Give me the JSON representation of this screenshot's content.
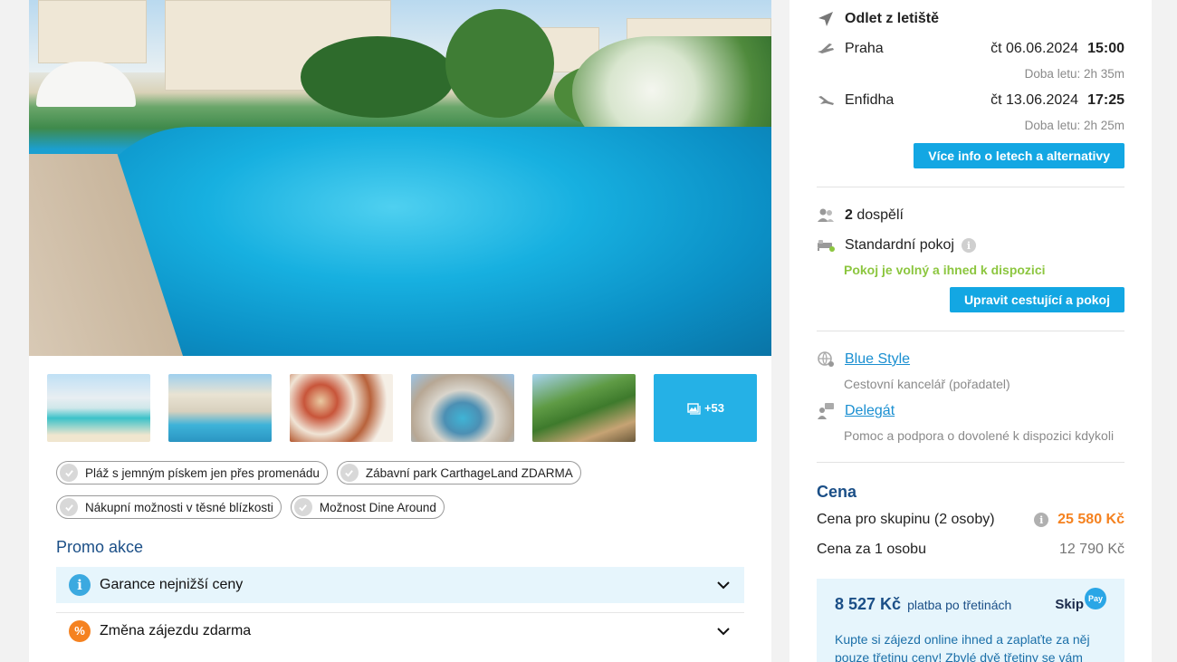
{
  "gallery": {
    "more_count": "+53"
  },
  "tags": [
    "Pláž s jemným pískem jen přes promenádu",
    "Zábavní park CarthageLand ZDARMA",
    "Nákupní možnosti v těsné blízkosti",
    "Možnost Dine Around"
  ],
  "promo": {
    "title": "Promo akce",
    "items": [
      {
        "label": "Garance nejnižší ceny",
        "icon": "info-icon"
      },
      {
        "label": "Změna zájezdu zdarma",
        "icon": "percent-icon"
      }
    ]
  },
  "flights": {
    "title": "Odlet z letiště",
    "outbound": {
      "city": "Praha",
      "date": "čt 06.06.2024",
      "time": "15:00",
      "duration": "Doba letu: 2h 35m"
    },
    "return": {
      "city": "Enfidha",
      "date": "čt 13.06.2024",
      "time": "17:25",
      "duration": "Doba letu: 2h 25m"
    },
    "more_button": "Více info o letech a alternativy"
  },
  "travellers": {
    "count": "2",
    "label": "dospělí",
    "room": "Standardní pokoj",
    "availability": "Pokoj je volný a ihned k dispozici",
    "edit_button": "Upravit cestující a pokoj"
  },
  "organizer": {
    "name": "Blue Style",
    "role": "Cestovní kancelář (pořadatel)",
    "delegate": "Delegát",
    "delegate_desc": "Pomoc a podpora o dovolené k dispozici kdykoli"
  },
  "price": {
    "title": "Cena",
    "group_label": "Cena pro skupinu (2 osoby)",
    "group_value": "25 580 Kč",
    "person_label": "Cena za 1 osobu",
    "person_value": "12 790 Kč"
  },
  "skippay": {
    "amount": "8 527 Kč",
    "suffix": "platba po třetinách",
    "logo_text": "Skip",
    "logo_badge": "Pay",
    "text": "Kupte si zájezd online ihned a zaplaťte za něj pouze třetinu ceny! Zbylé dvě třetiny se vám"
  },
  "colors": {
    "accent_blue": "#13a7e3",
    "heading_navy": "#1b4f87",
    "price_orange": "#f58220",
    "available_green": "#8cc63f"
  }
}
